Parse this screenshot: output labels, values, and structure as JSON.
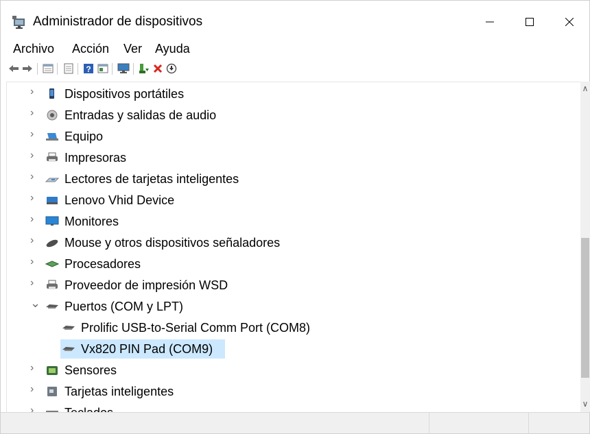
{
  "window": {
    "title": "Administrador de dispositivos",
    "icon": "device-manager-icon",
    "controls": {
      "minimize": "—",
      "maximize": "☐",
      "close": "✕"
    }
  },
  "menubar": {
    "items": [
      {
        "label": "Archivo"
      },
      {
        "label": "Acción"
      },
      {
        "label": "Ver"
      },
      {
        "label": "Ayuda"
      }
    ]
  },
  "toolbar": {
    "buttons": [
      "back-arrow-icon",
      "forward-arrow-icon",
      "properties-icon",
      "show-hidden-icon",
      "help-icon",
      "action-view-icon",
      "monitor-icon",
      "enable-device-icon",
      "uninstall-icon",
      "update-driver-icon"
    ]
  },
  "tree": {
    "items": [
      {
        "label": "Dispositivos portátiles",
        "expander": "›",
        "icon": "portable-device-icon",
        "level": 0
      },
      {
        "label": "Entradas y salidas de audio",
        "expander": "›",
        "icon": "audio-icon",
        "level": 0
      },
      {
        "label": "Equipo",
        "expander": "›",
        "icon": "computer-icon",
        "level": 0
      },
      {
        "label": "Impresoras",
        "expander": "›",
        "icon": "printer-icon",
        "level": 0
      },
      {
        "label": "Lectores de tarjetas inteligentes",
        "expander": "›",
        "icon": "smartcard-reader-icon",
        "level": 0
      },
      {
        "label": "Lenovo Vhid Device",
        "expander": "›",
        "icon": "hid-device-icon",
        "level": 0
      },
      {
        "label": "Monitores",
        "expander": "›",
        "icon": "monitor-icon",
        "level": 0
      },
      {
        "label": "Mouse y otros dispositivos señaladores",
        "expander": "›",
        "icon": "mouse-icon",
        "level": 0
      },
      {
        "label": "Procesadores",
        "expander": "›",
        "icon": "processor-icon",
        "level": 0
      },
      {
        "label": "Proveedor de impresión WSD",
        "expander": "›",
        "icon": "printer-icon",
        "level": 0
      },
      {
        "label": "Puertos (COM y LPT)",
        "expander": "⌄",
        "icon": "port-icon",
        "level": 0
      },
      {
        "label": "Prolific USB-to-Serial Comm Port (COM8)",
        "expander": "",
        "icon": "port-icon",
        "level": 1
      },
      {
        "label": "Vx820 PIN Pad (COM9)",
        "expander": "",
        "icon": "port-icon",
        "level": 1,
        "selected": true
      },
      {
        "label": "Sensores",
        "expander": "›",
        "icon": "sensor-icon",
        "level": 0
      },
      {
        "label": "Tarjetas inteligentes",
        "expander": "›",
        "icon": "smartcard-icon",
        "level": 0
      },
      {
        "label": "Teclados",
        "expander": "›",
        "icon": "keyboard-icon",
        "level": 0
      }
    ]
  },
  "scrollbar": {
    "up": "∧",
    "down": "∨",
    "position_fraction": 0.55
  },
  "colors": {
    "selection": "#cce8ff",
    "chrome": "#f0f0f0"
  }
}
